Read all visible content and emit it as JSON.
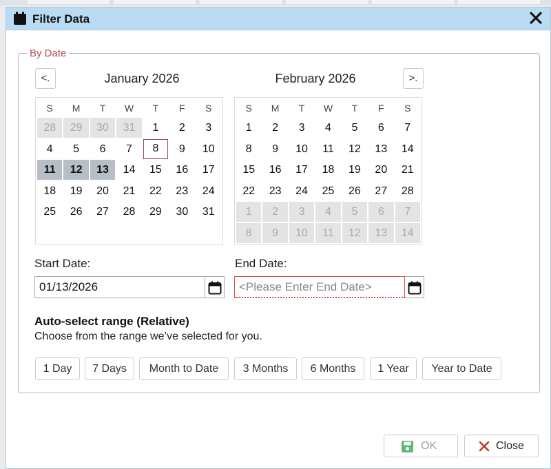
{
  "dialog": {
    "title": "Filter Data"
  },
  "by_date": {
    "legend": "By Date",
    "prev_label": "<.",
    "next_label": ">.",
    "weekday_headers": [
      "S",
      "M",
      "T",
      "W",
      "T",
      "F",
      "S"
    ],
    "months": [
      {
        "title": "January 2026",
        "weeks": [
          [
            {
              "d": "28",
              "t": "other"
            },
            {
              "d": "29",
              "t": "other"
            },
            {
              "d": "30",
              "t": "other"
            },
            {
              "d": "31",
              "t": "other"
            },
            {
              "d": "1"
            },
            {
              "d": "2"
            },
            {
              "d": "3"
            }
          ],
          [
            {
              "d": "4"
            },
            {
              "d": "5"
            },
            {
              "d": "6"
            },
            {
              "d": "7"
            },
            {
              "d": "8",
              "t": "today"
            },
            {
              "d": "9"
            },
            {
              "d": "10"
            }
          ],
          [
            {
              "d": "11",
              "t": "selected"
            },
            {
              "d": "12",
              "t": "selected"
            },
            {
              "d": "13",
              "t": "selected"
            },
            {
              "d": "14"
            },
            {
              "d": "15"
            },
            {
              "d": "16"
            },
            {
              "d": "17"
            }
          ],
          [
            {
              "d": "18"
            },
            {
              "d": "19"
            },
            {
              "d": "20"
            },
            {
              "d": "21"
            },
            {
              "d": "22"
            },
            {
              "d": "23"
            },
            {
              "d": "24"
            }
          ],
          [
            {
              "d": "25"
            },
            {
              "d": "26"
            },
            {
              "d": "27"
            },
            {
              "d": "28"
            },
            {
              "d": "29"
            },
            {
              "d": "30"
            },
            {
              "d": "31"
            }
          ]
        ]
      },
      {
        "title": "February 2026",
        "weeks": [
          [
            {
              "d": "1"
            },
            {
              "d": "2"
            },
            {
              "d": "3"
            },
            {
              "d": "4"
            },
            {
              "d": "5"
            },
            {
              "d": "6"
            },
            {
              "d": "7"
            }
          ],
          [
            {
              "d": "8"
            },
            {
              "d": "9"
            },
            {
              "d": "10"
            },
            {
              "d": "11"
            },
            {
              "d": "12"
            },
            {
              "d": "13"
            },
            {
              "d": "14"
            }
          ],
          [
            {
              "d": "15"
            },
            {
              "d": "16"
            },
            {
              "d": "17"
            },
            {
              "d": "18"
            },
            {
              "d": "19"
            },
            {
              "d": "20"
            },
            {
              "d": "21"
            }
          ],
          [
            {
              "d": "22"
            },
            {
              "d": "23"
            },
            {
              "d": "24"
            },
            {
              "d": "25"
            },
            {
              "d": "26"
            },
            {
              "d": "27"
            },
            {
              "d": "28"
            }
          ],
          [
            {
              "d": "1",
              "t": "other"
            },
            {
              "d": "2",
              "t": "other"
            },
            {
              "d": "3",
              "t": "other"
            },
            {
              "d": "4",
              "t": "other"
            },
            {
              "d": "5",
              "t": "other"
            },
            {
              "d": "6",
              "t": "other"
            },
            {
              "d": "7",
              "t": "other"
            }
          ],
          [
            {
              "d": "8",
              "t": "other"
            },
            {
              "d": "9",
              "t": "other"
            },
            {
              "d": "10",
              "t": "other"
            },
            {
              "d": "11",
              "t": "other"
            },
            {
              "d": "12",
              "t": "other"
            },
            {
              "d": "13",
              "t": "other"
            },
            {
              "d": "14",
              "t": "other"
            }
          ]
        ]
      }
    ],
    "start": {
      "label": "Start Date:",
      "value": "01/13/2026"
    },
    "end": {
      "label": "End Date:",
      "value": "",
      "placeholder": "<Please Enter End Date>"
    }
  },
  "auto_range": {
    "title": "Auto-select range (Relative)",
    "subtitle": "Choose from the range we’ve selected for you.",
    "buttons": [
      "1 Day",
      "7 Days",
      "Month to Date",
      "3 Months",
      "6 Months",
      "1 Year",
      "Year to Date"
    ]
  },
  "footer": {
    "ok_label": "OK",
    "close_label": "Close"
  },
  "colors": {
    "titlebar": "#b9dcf4",
    "legend": "#b04d4d",
    "selected_day": "#b7bec6",
    "today_border": "#a24848",
    "ok_icon": "#3aa35c",
    "close_icon": "#c0392b"
  }
}
